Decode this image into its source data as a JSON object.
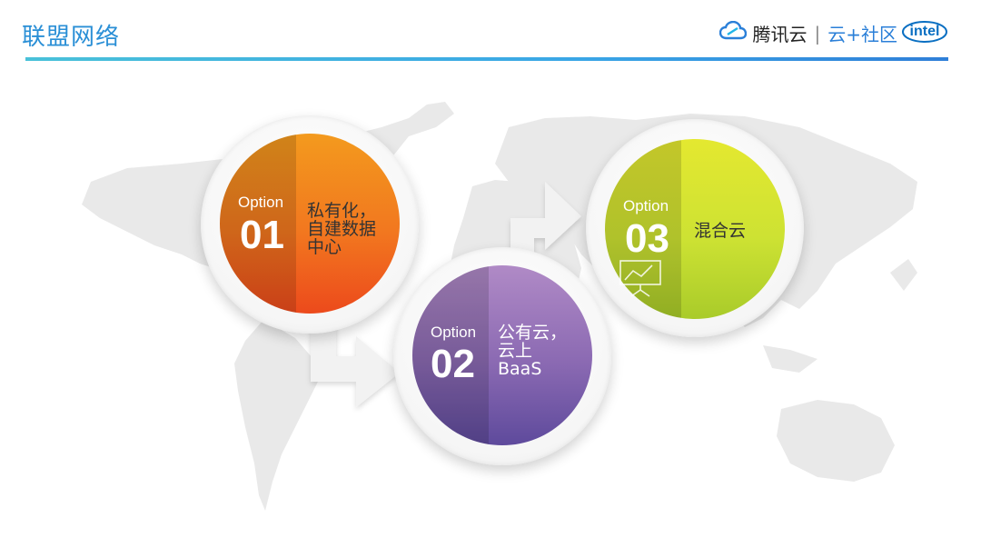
{
  "header": {
    "title": "联盟网络",
    "brand_tencent": "腾讯云",
    "brand_separator": "|",
    "brand_community": "云+社区",
    "brand_intel": "intel"
  },
  "options": [
    {
      "label": "Option",
      "number": "01",
      "text_lines": [
        "私有化，",
        "自建数据",
        "中心"
      ],
      "color_top": "#f39a1e",
      "color_bottom": "#ec4a1c"
    },
    {
      "label": "Option",
      "number": "02",
      "text_lines": [
        "公有云，",
        "云上",
        "BaaS"
      ],
      "color_top": "#b08ac6",
      "color_bottom": "#5e4a9c"
    },
    {
      "label": "Option",
      "number": "03",
      "text_lines": [
        "混合云"
      ],
      "color_top": "#e4e830",
      "color_bottom": "#a9cb2a"
    }
  ],
  "icons": {
    "cloud": "tencent-cloud-icon",
    "chart": "presentation-chart-icon"
  },
  "colors": {
    "title": "#2a8fd6",
    "map": "#e9e9e9",
    "arrow": "#eeeeee"
  }
}
